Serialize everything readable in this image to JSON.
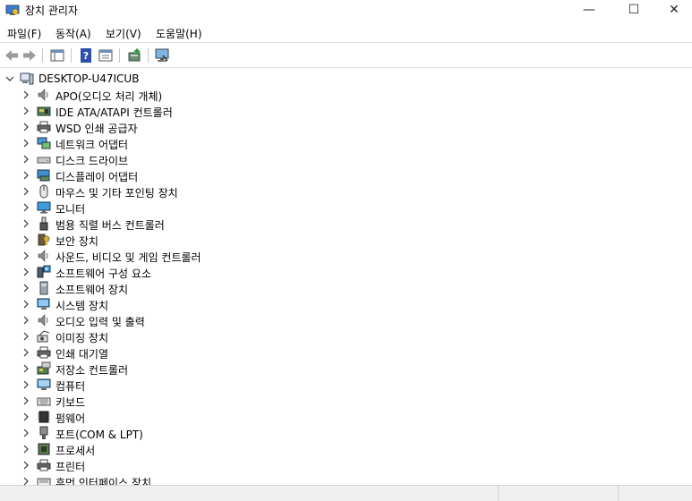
{
  "window": {
    "title": "장치 관리자",
    "minimize": "—",
    "maximize": "☐",
    "close": "✕"
  },
  "menu": [
    {
      "label": "파일(F)"
    },
    {
      "label": "동작(A)"
    },
    {
      "label": "보기(V)"
    },
    {
      "label": "도움말(H)"
    }
  ],
  "tree": {
    "root": "DESKTOP-U47ICUB",
    "items": [
      {
        "label": "APO(오디오 처리 개체)",
        "icon": "speaker-icon"
      },
      {
        "label": "IDE ATA/ATAPI 컨트롤러",
        "icon": "ide-controller-icon"
      },
      {
        "label": "WSD 인쇄 공급자",
        "icon": "printer-icon"
      },
      {
        "label": "네트워크 어댑터",
        "icon": "network-adapter-icon"
      },
      {
        "label": "디스크 드라이브",
        "icon": "disk-drive-icon"
      },
      {
        "label": "디스플레이 어댑터",
        "icon": "display-adapter-icon"
      },
      {
        "label": "마우스 및 기타 포인팅 장치",
        "icon": "mouse-icon"
      },
      {
        "label": "모니터",
        "icon": "monitor-icon"
      },
      {
        "label": "범용 직렬 버스 컨트롤러",
        "icon": "usb-icon"
      },
      {
        "label": "보안 장치",
        "icon": "security-key-icon"
      },
      {
        "label": "사운드, 비디오 및 게임 컨트롤러",
        "icon": "speaker-icon"
      },
      {
        "label": "소프트웨어 구성 요소",
        "icon": "software-component-icon"
      },
      {
        "label": "소프트웨어 장치",
        "icon": "software-device-icon"
      },
      {
        "label": "시스템 장치",
        "icon": "system-device-icon"
      },
      {
        "label": "오디오 입력 및 출력",
        "icon": "speaker-icon"
      },
      {
        "label": "이미징 장치",
        "icon": "camera-icon"
      },
      {
        "label": "인쇄 대기열",
        "icon": "printer-icon"
      },
      {
        "label": "저장소 컨트롤러",
        "icon": "storage-controller-icon"
      },
      {
        "label": "컴퓨터",
        "icon": "computer-icon"
      },
      {
        "label": "키보드",
        "icon": "keyboard-icon"
      },
      {
        "label": "펌웨어",
        "icon": "firmware-icon"
      },
      {
        "label": "포트(COM & LPT)",
        "icon": "port-icon"
      },
      {
        "label": "프로세서",
        "icon": "processor-icon"
      },
      {
        "label": "프린터",
        "icon": "printer-icon"
      },
      {
        "label": "휴먼 인터페이스 장치",
        "icon": "hid-icon"
      }
    ]
  }
}
